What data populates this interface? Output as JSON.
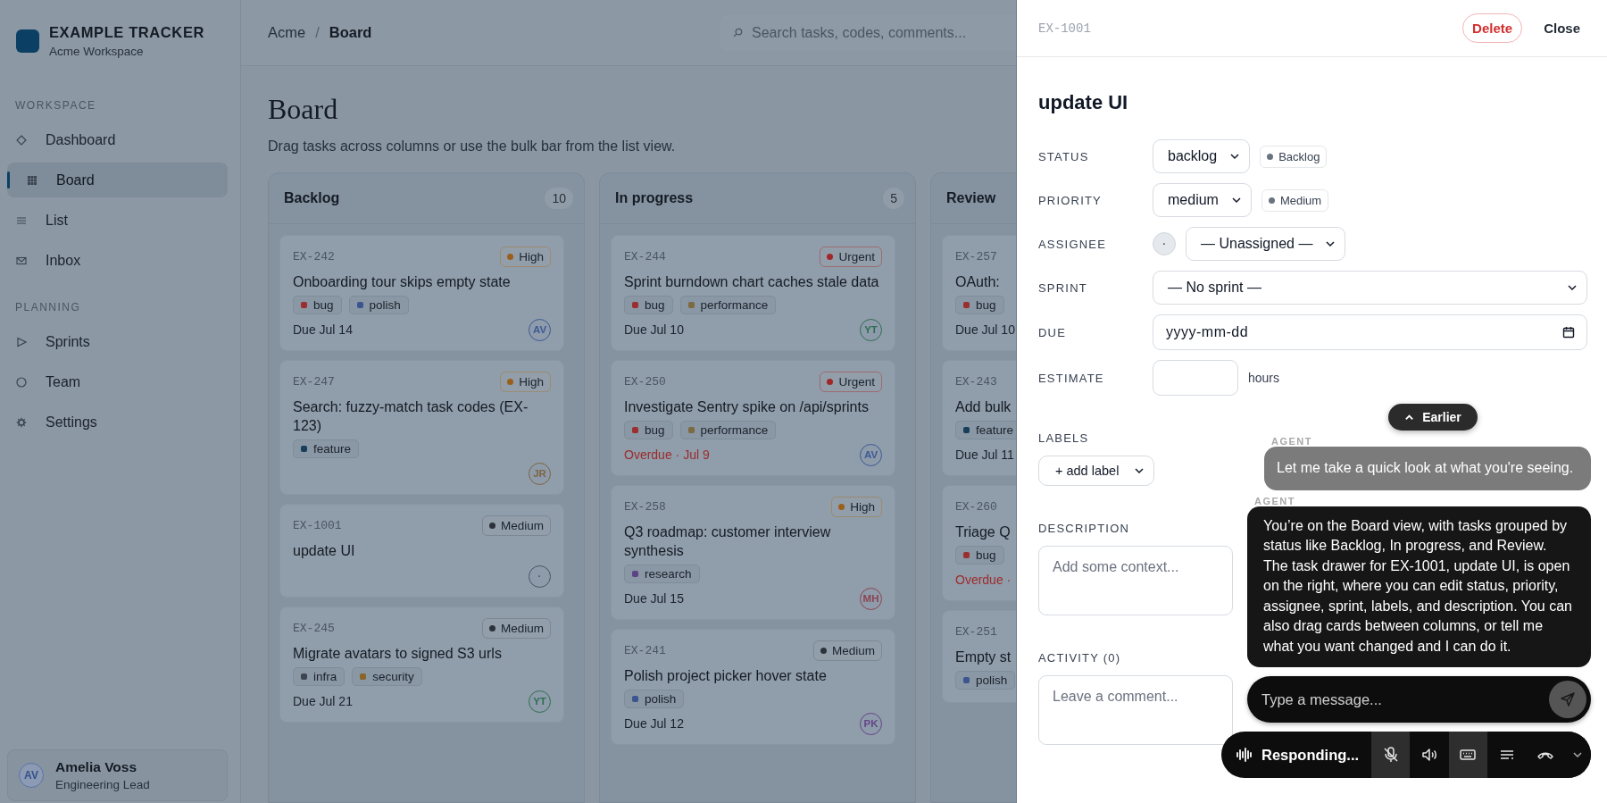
{
  "sidebar": {
    "brand": {
      "title": "EXAMPLE TRACKER",
      "subtitle": "Acme Workspace"
    },
    "sections": [
      {
        "heading": "WORKSPACE",
        "items": [
          {
            "label": "Dashboard",
            "selected": false
          },
          {
            "label": "Board",
            "selected": true
          },
          {
            "label": "List",
            "selected": false
          },
          {
            "label": "Inbox",
            "selected": false
          }
        ]
      },
      {
        "heading": "PLANNING",
        "items": [
          {
            "label": "Sprints",
            "selected": false
          },
          {
            "label": "Team",
            "selected": false
          },
          {
            "label": "Settings",
            "selected": false
          }
        ]
      }
    ],
    "user": {
      "initials": "AV",
      "name": "Amelia Voss",
      "role": "Engineering Lead"
    }
  },
  "header": {
    "breadcrumb": [
      "Acme",
      "Board"
    ],
    "separator": "/",
    "search": {
      "placeholder": "Search tasks, codes, comments..."
    }
  },
  "board": {
    "title": "Board",
    "subtitle": "Drag tasks across columns or use the bulk bar from the list view.",
    "columns": [
      {
        "title": "Backlog",
        "count": "10",
        "cards": [
          {
            "code": "EX-242",
            "priority": {
              "label": "High",
              "kind": "high"
            },
            "title": "Onboarding tour skips empty state",
            "tags": [
              {
                "label": "bug",
                "color": "#9b2f2f"
              },
              {
                "label": "polish",
                "color": "#3a5590"
              }
            ],
            "due": {
              "text": "Due Jul 14",
              "overdue": false
            },
            "assignee": {
              "initials": "AV",
              "color": "#3c5a93"
            }
          },
          {
            "code": "EX-247",
            "priority": {
              "label": "High",
              "kind": "high"
            },
            "title": "Search: fuzzy-match task codes (EX-123)",
            "tags": [
              {
                "label": "feature",
                "color": "#173f5a"
              }
            ],
            "assignee": {
              "initials": "JR",
              "color": "#7d6640"
            }
          },
          {
            "code": "EX-1001",
            "priority": {
              "label": "Medium",
              "kind": "medium"
            },
            "title": "update UI",
            "assignee": {
              "initials": "·",
              "color": "#4b5563"
            }
          },
          {
            "code": "EX-245",
            "priority": {
              "label": "Medium",
              "kind": "medium"
            },
            "title": "Migrate avatars to signed S3 urls",
            "tags": [
              {
                "label": "infra",
                "color": "#3c4450"
              },
              {
                "label": "security",
                "color": "#8a6428"
              }
            ],
            "due": {
              "text": "Due Jul 21",
              "overdue": false
            },
            "assignee": {
              "initials": "YT",
              "color": "#2e6f50"
            }
          }
        ]
      },
      {
        "title": "In progress",
        "count": "5",
        "cards": [
          {
            "code": "EX-244",
            "priority": {
              "label": "Urgent",
              "kind": "urgent"
            },
            "title": "Sprint burndown chart caches stale data",
            "tags": [
              {
                "label": "bug",
                "color": "#9b2f2f"
              },
              {
                "label": "performance",
                "color": "#7c6a40"
              }
            ],
            "due": {
              "text": "Due Jul 10",
              "overdue": false
            },
            "assignee": {
              "initials": "YT",
              "color": "#2e6f50"
            }
          },
          {
            "code": "EX-250",
            "priority": {
              "label": "Urgent",
              "kind": "urgent"
            },
            "title": "Investigate Sentry spike on /api/sprints",
            "tags": [
              {
                "label": "bug",
                "color": "#9b2f2f"
              },
              {
                "label": "performance",
                "color": "#7c6a40"
              }
            ],
            "due": {
              "text": "Overdue · Jul 9",
              "overdue": true
            },
            "assignee": {
              "initials": "AV",
              "color": "#3c5a93"
            }
          },
          {
            "code": "EX-258",
            "priority": {
              "label": "High",
              "kind": "high"
            },
            "title": "Q3 roadmap: customer interview synthesis",
            "tags": [
              {
                "label": "research",
                "color": "#5c4585"
              }
            ],
            "due": {
              "text": "Due Jul 15",
              "overdue": false
            },
            "assignee": {
              "initials": "MH",
              "color": "#8e4450"
            }
          },
          {
            "code": "EX-241",
            "priority": {
              "label": "Medium",
              "kind": "medium"
            },
            "title": "Polish project picker hover state",
            "tags": [
              {
                "label": "polish",
                "color": "#3a5590"
              }
            ],
            "due": {
              "text": "Due Jul 12",
              "overdue": false
            },
            "assignee": {
              "initials": "PK",
              "color": "#634587"
            }
          }
        ]
      },
      {
        "title": "Review",
        "cards": [
          {
            "code": "EX-257",
            "title": "OAuth:",
            "tags": [
              {
                "label": "bug",
                "color": "#9b2f2f"
              }
            ],
            "due": {
              "text": "Due Jul 10",
              "overdue": false
            }
          },
          {
            "code": "EX-243",
            "title": "Add bulk",
            "tags": [
              {
                "label": "feature",
                "color": "#173f5a"
              }
            ],
            "due": {
              "text": "Due Jul 11",
              "overdue": false
            }
          },
          {
            "code": "EX-260",
            "title": "Triage Q",
            "tags": [
              {
                "label": "bug",
                "color": "#9b2f2f"
              }
            ],
            "due": {
              "text": "Overdue ·",
              "overdue": true
            }
          },
          {
            "code": "EX-251",
            "title": "Empty st",
            "tags": [
              {
                "label": "polish",
                "color": "#3a5590"
              }
            ]
          }
        ]
      }
    ]
  },
  "drawer": {
    "code": "EX-1001",
    "buttons": [
      {
        "label": "Delete",
        "kind": "danger"
      },
      {
        "label": "Close",
        "kind": "plain"
      }
    ],
    "title": "update UI",
    "fields": [
      {
        "label": "STATUS",
        "kind": "select",
        "value": "backlog",
        "badge": "Backlog"
      },
      {
        "label": "PRIORITY",
        "kind": "select",
        "value": "medium",
        "badge": "Medium"
      },
      {
        "label": "ASSIGNEE",
        "kind": "assignee",
        "avatar": "·",
        "value": "— Unassigned —"
      },
      {
        "label": "SPRINT",
        "kind": "wide-select",
        "value": "— No sprint —"
      },
      {
        "label": "DUE",
        "kind": "date",
        "placeholder": "yyyy-mm-dd"
      },
      {
        "label": "ESTIMATE",
        "kind": "number",
        "unit": "hours"
      }
    ],
    "labels": {
      "heading": "LABELS",
      "control": "+ add label"
    },
    "description": {
      "heading": "DESCRIPTION",
      "placeholder": "Add some context..."
    },
    "activity": {
      "heading": "ACTIVITY (0)",
      "placeholder": "Leave a comment..."
    }
  },
  "chat": {
    "earlier": "Earlier",
    "messages": [
      {
        "sender": "AGENT",
        "kind": "muted",
        "text": "Let me take a quick look at what you're seeing."
      },
      {
        "sender": "AGENT",
        "kind": "dark",
        "text": "You’re on the Board view, with tasks grouped by status like Backlog, In progress, and Review. The task drawer for EX-1001, update UI, is open on the right, where you can edit status, priority, assignee, sprint, labels, and description. You can also drag cards between columns, or tell me what you want changed and I can do it."
      }
    ],
    "input": {
      "placeholder": "Type a message..."
    },
    "voice": {
      "status": "Responding...",
      "controls": [
        {
          "kind": "mic-off",
          "on": true
        },
        {
          "kind": "speaker",
          "on": false
        },
        {
          "kind": "keyboard",
          "on": true
        },
        {
          "kind": "transcript",
          "on": false
        },
        {
          "kind": "hangup",
          "on": false
        },
        {
          "kind": "chevron",
          "on": false
        }
      ]
    }
  }
}
